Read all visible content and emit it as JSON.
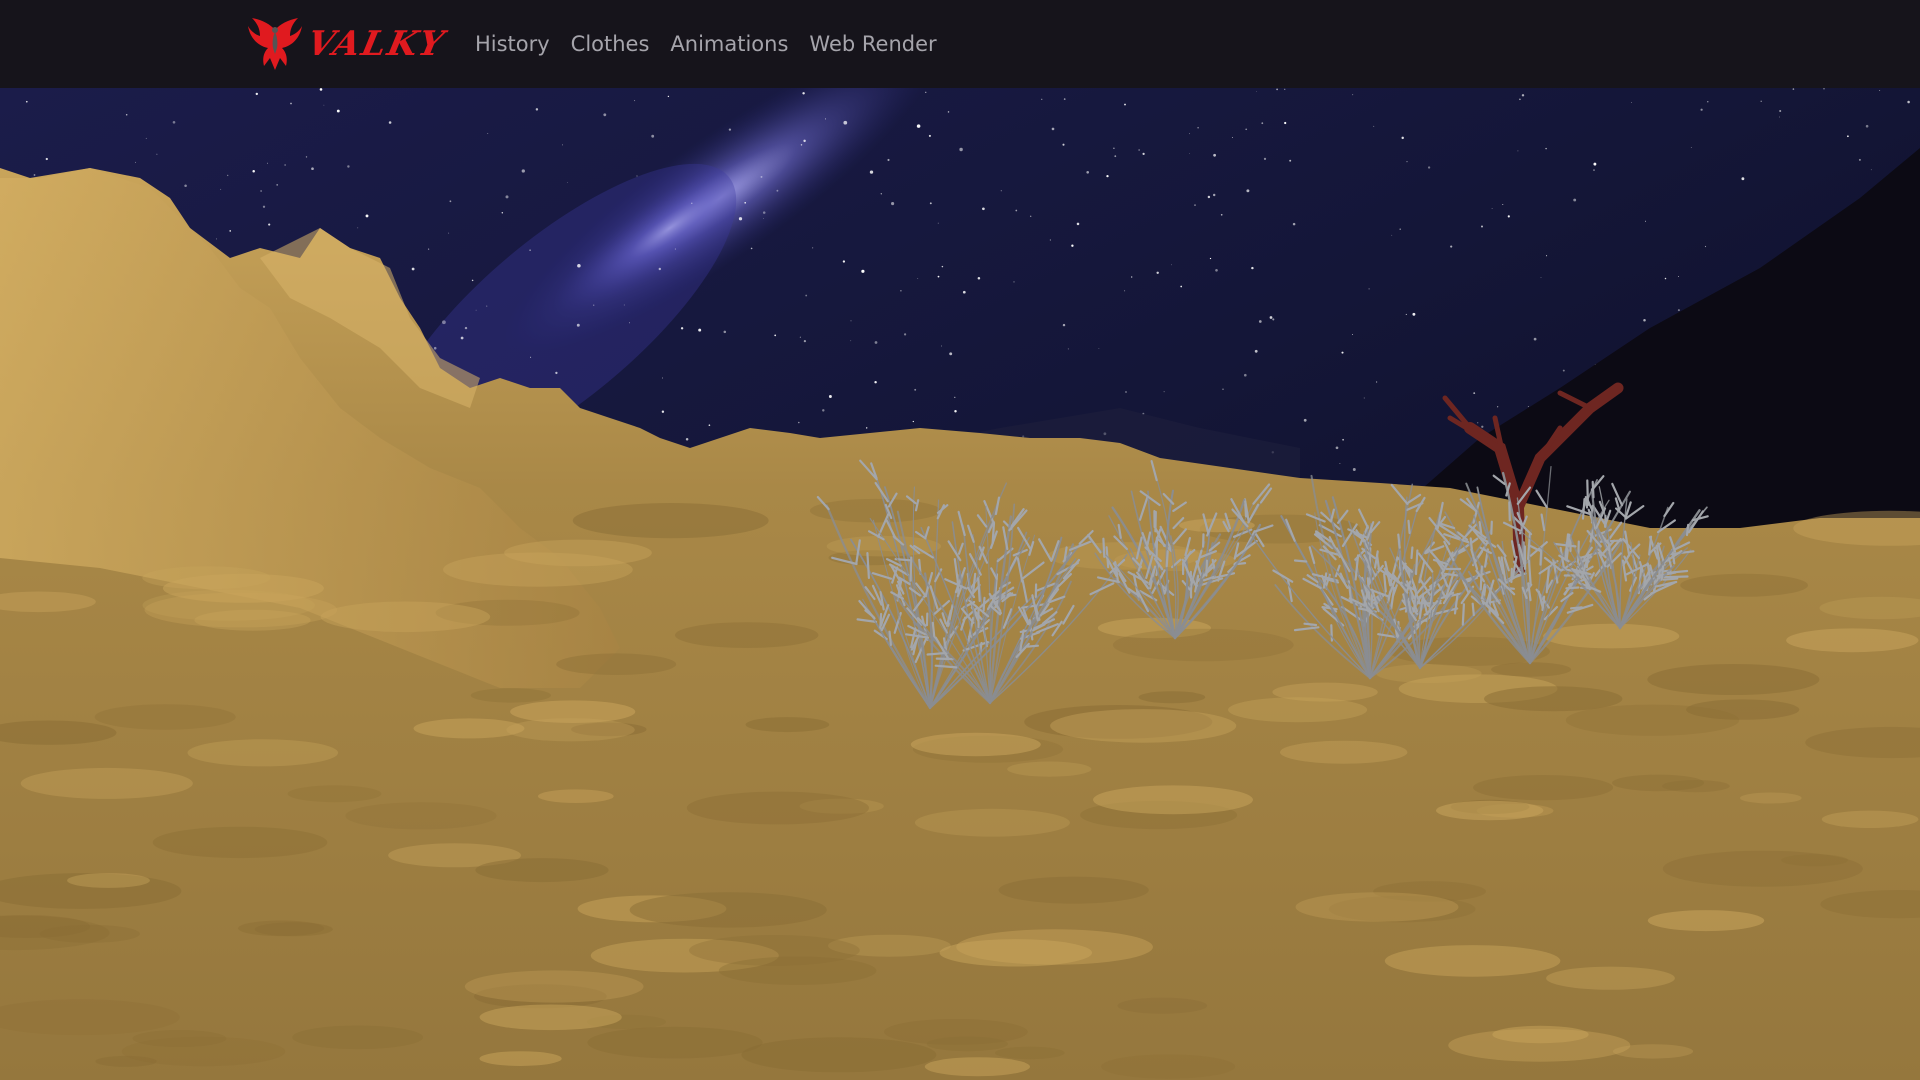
{
  "navbar": {
    "brand": {
      "text": "VALKY",
      "icon": "phoenix-icon",
      "color": "#e01a1f"
    },
    "links": [
      {
        "label": "History"
      },
      {
        "label": "Clothes"
      },
      {
        "label": "Animations"
      },
      {
        "label": "Web Render"
      }
    ]
  },
  "scene": {
    "sky_color": "#121432",
    "terrain_color": "#a88444",
    "plant_color": "#8a8d92",
    "dead_tree_color": "#6b2420"
  }
}
